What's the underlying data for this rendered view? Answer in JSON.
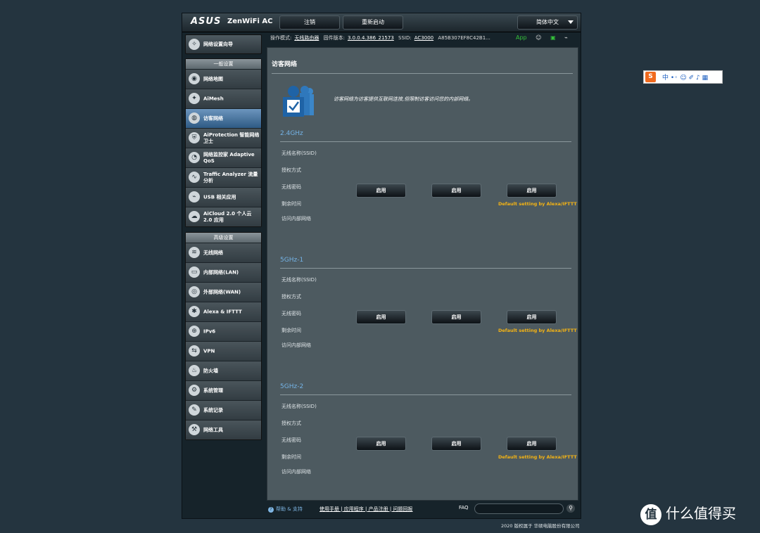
{
  "header": {
    "logo": "ASUS",
    "model": "ZenWiFi AC",
    "logout": "注销",
    "reboot": "重新启动",
    "language": "简体中文"
  },
  "status": {
    "mode_label": "操作模式:",
    "mode_value": "无线路由器",
    "fw_label": "固件版本:",
    "fw_value": "3.0.0.4.386_21573",
    "ssid_label": "SSID:",
    "ssid_value": "AC3000",
    "mac_value": "A85B307EF8C42B1...",
    "app": "App"
  },
  "sidebar": {
    "qis": "网络设置向导",
    "general_head": "一般设置",
    "general": [
      {
        "label": "网络地图",
        "icon": "network-map-icon",
        "glyph": "◉"
      },
      {
        "label": "AiMesh",
        "icon": "aimesh-icon",
        "glyph": "✦"
      },
      {
        "label": "访客网络",
        "icon": "guest-network-icon",
        "glyph": "◍",
        "active": true
      },
      {
        "label": "AiProtection 智能网络卫士",
        "icon": "shield-icon",
        "glyph": "⛨"
      },
      {
        "label": "网络监控家 Adaptive QoS",
        "icon": "gauge-icon",
        "glyph": "◔"
      },
      {
        "label": "Traffic Analyzer 流量分析",
        "icon": "traffic-icon",
        "glyph": "∿"
      },
      {
        "label": "USB 相关应用",
        "icon": "usb-icon",
        "glyph": "⌁"
      },
      {
        "label": "AiCloud 2.0 个人云 2.0 应用",
        "icon": "cloud-icon",
        "glyph": "☁"
      }
    ],
    "advanced_head": "高级设置",
    "advanced": [
      {
        "label": "无线网络",
        "icon": "wireless-icon",
        "glyph": "≋"
      },
      {
        "label": "内部网络(LAN)",
        "icon": "lan-icon",
        "glyph": "▭"
      },
      {
        "label": "外部网络(WAN)",
        "icon": "wan-icon",
        "glyph": "◎"
      },
      {
        "label": "Alexa & IFTTT",
        "icon": "alexa-icon",
        "glyph": "✱"
      },
      {
        "label": "IPv6",
        "icon": "ipv6-icon",
        "glyph": "⊕"
      },
      {
        "label": "VPN",
        "icon": "vpn-icon",
        "glyph": "⇆"
      },
      {
        "label": "防火墙",
        "icon": "firewall-icon",
        "glyph": "♨"
      },
      {
        "label": "系统管理",
        "icon": "admin-icon",
        "glyph": "⚙"
      },
      {
        "label": "系统记录",
        "icon": "log-icon",
        "glyph": "✎"
      },
      {
        "label": "网络工具",
        "icon": "tools-icon",
        "glyph": "⚒"
      }
    ]
  },
  "main": {
    "title": "访客网络",
    "description": "访客网络为访客提供互联网连接,但限制访客访问您的内部网络。",
    "field_labels": [
      "无线名称(SSID)",
      "授权方式",
      "无线密码",
      "剩余时间",
      "访问内部网络"
    ],
    "enable_label": "启用",
    "alexa_note": "Default setting by Alexa/IFTTT",
    "bands": [
      "2.4GHz",
      "5GHz-1",
      "5GHz-2"
    ]
  },
  "footer": {
    "help": "帮助 & 支持",
    "links": "使用手册 | 应用程序 | 产品注册 | 问题回报",
    "faq": "FAQ",
    "copyright": "2020 版权属于 华硕电脑股份有限公司"
  },
  "overlay": {
    "ime_tools": "中 •◦ ☺ ✐ ♪ ▦",
    "watermark": "什么值得买",
    "watermark_logo": "值"
  },
  "colors": {
    "accent_blue": "#74b3e6",
    "alexa_yellow": "#f5b414",
    "active_item": "#2e5a84"
  }
}
